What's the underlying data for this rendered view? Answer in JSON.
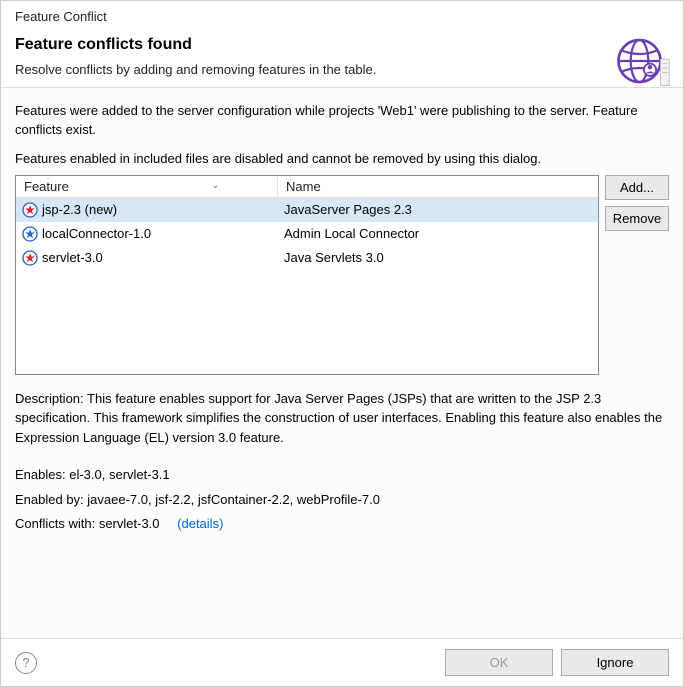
{
  "window_title": "Feature Conflict",
  "heading": "Feature conflicts found",
  "subheading": "Resolve conflicts by adding and removing features in the table.",
  "intro": "Features were added to the server configuration while projects 'Web1' were publishing to the server. Feature conflicts exist.",
  "intro2": "Features enabled in included files are disabled and cannot be removed by using this dialog.",
  "columns": {
    "feature": "Feature",
    "name": "Name"
  },
  "rows": [
    {
      "feature": "jsp-2.3 (new)",
      "name": "JavaServer Pages 2.3",
      "icon": "star-red",
      "selected": true
    },
    {
      "feature": "localConnector-1.0",
      "name": "Admin Local Connector",
      "icon": "star-blue",
      "selected": false
    },
    {
      "feature": "servlet-3.0",
      "name": "Java Servlets 3.0",
      "icon": "star-red",
      "selected": false
    }
  ],
  "buttons": {
    "add": "Add...",
    "remove": "Remove"
  },
  "description_label": "Description:",
  "description": "This feature enables support for Java Server Pages (JSPs) that are written to the JSP 2.3 specification. This framework simplifies the construction of user interfaces. Enabling this feature also enables the Expression Language (EL) version 3.0 feature.",
  "enables_label": "Enables:",
  "enables": "el-3.0, servlet-3.1",
  "enabled_by_label": "Enabled by:",
  "enabled_by": "javaee-7.0, jsf-2.2, jsfContainer-2.2, webProfile-7.0",
  "conflicts_label": "Conflicts with:",
  "conflicts": "servlet-3.0",
  "details": "(details)",
  "footer": {
    "ok": "OK",
    "ignore": "Ignore"
  }
}
